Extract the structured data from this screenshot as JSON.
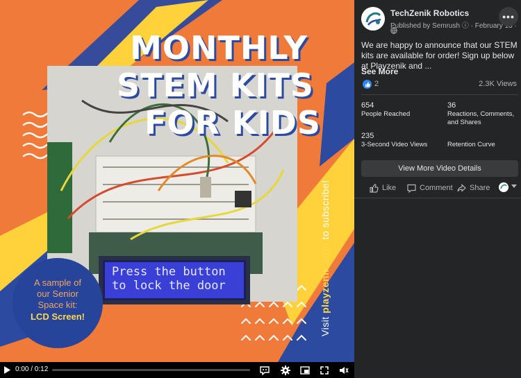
{
  "video": {
    "headline": [
      "MONTHLY",
      "STEM KITS",
      "FOR KIDS"
    ],
    "lcd": {
      "line1": "Press the button",
      "line2": "to lock the door"
    },
    "circle": [
      "A sample of",
      "our Senior",
      "Space kit:",
      "LCD Screen!"
    ],
    "visit_prefix": "Visit ",
    "visit_site": "playzenik.com",
    "visit_suffix": " to subscribe!",
    "time": "0:00 / 0:12",
    "progress": 0.0
  },
  "post": {
    "page_name": "TechZenik Robotics",
    "meta": "Published by Semrush ⓘ · February 13 ·",
    "body": "We are happy to announce that our STEM kits are available for order! Sign up below at Playzenik and ...",
    "see_more": "See More",
    "like_count": "2",
    "views": "2.3K Views",
    "stats": [
      {
        "num": "654",
        "label": "People Reached"
      },
      {
        "num": "36",
        "label": "Reactions, Comments, and Shares"
      },
      {
        "num": "235",
        "label": "3-Second Video Views"
      },
      {
        "num": "",
        "label": "Retention Curve"
      }
    ],
    "details_button": "View More Video Details",
    "actions": {
      "like": "Like",
      "comment": "Comment",
      "share": "Share"
    }
  },
  "colors": {
    "video_bg": "#f07a3a",
    "brand_blue": "#2b4aa0",
    "accent_yellow": "#ffd84a",
    "panel_bg": "#242526",
    "like_blue": "#2d88ff"
  },
  "icons": [
    "play-icon",
    "captions-icon",
    "settings-icon",
    "picture-in-picture-icon",
    "fullscreen-icon",
    "volume-icon",
    "globe-icon",
    "more-icon",
    "like-icon",
    "comment-icon",
    "share-icon"
  ]
}
